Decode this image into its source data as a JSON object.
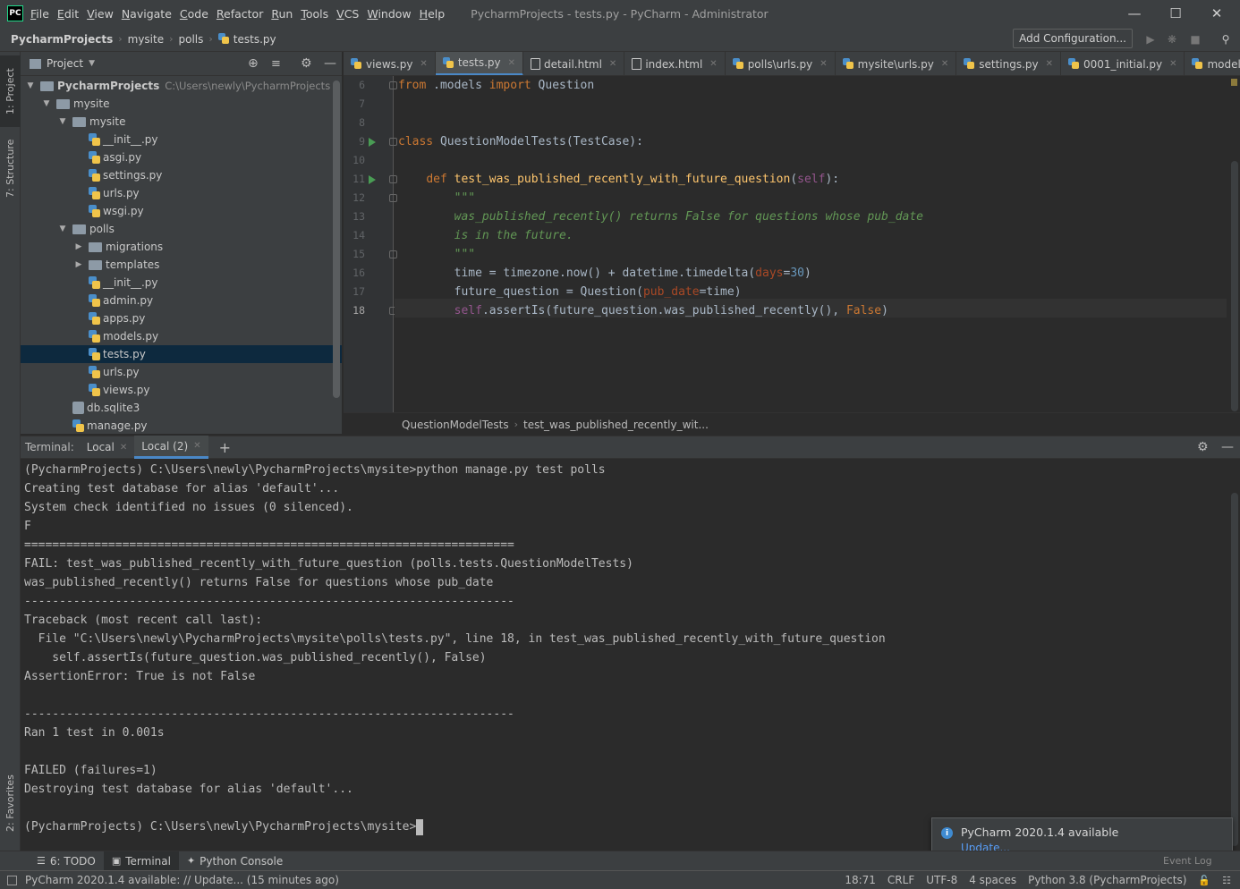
{
  "window": {
    "logo": "PC",
    "menu": [
      "File",
      "Edit",
      "View",
      "Navigate",
      "Code",
      "Refactor",
      "Run",
      "Tools",
      "VCS",
      "Window",
      "Help"
    ],
    "title": "PycharmProjects - tests.py - PyCharm - Administrator",
    "minimize_icon": "minimize-icon",
    "maximize_icon": "maximize-icon",
    "close_icon": "close-icon"
  },
  "navbar": {
    "breadcrumb": [
      "PycharmProjects",
      "mysite",
      "polls",
      "tests.py"
    ],
    "add_configuration": "Add Configuration..."
  },
  "left_strip": {
    "project": "1: Project",
    "structure": "7: Structure",
    "favorites": "2: Favorites"
  },
  "project_panel": {
    "title": "Project",
    "tree": [
      {
        "label": "PycharmProjects",
        "path": "C:\\Users\\newly\\PycharmProjects",
        "type": "folder",
        "depth": 0,
        "expanded": true
      },
      {
        "label": "mysite",
        "type": "folder",
        "depth": 1,
        "expanded": true
      },
      {
        "label": "mysite",
        "type": "folder",
        "depth": 2,
        "expanded": true
      },
      {
        "label": "__init__.py",
        "type": "py",
        "depth": 3
      },
      {
        "label": "asgi.py",
        "type": "py",
        "depth": 3
      },
      {
        "label": "settings.py",
        "type": "py",
        "depth": 3
      },
      {
        "label": "urls.py",
        "type": "py",
        "depth": 3
      },
      {
        "label": "wsgi.py",
        "type": "py",
        "depth": 3
      },
      {
        "label": "polls",
        "type": "folder",
        "depth": 2,
        "expanded": true
      },
      {
        "label": "migrations",
        "type": "folder",
        "depth": 3,
        "expanded": false
      },
      {
        "label": "templates",
        "type": "folder",
        "depth": 3,
        "expanded": false
      },
      {
        "label": "__init__.py",
        "type": "py",
        "depth": 3
      },
      {
        "label": "admin.py",
        "type": "py",
        "depth": 3
      },
      {
        "label": "apps.py",
        "type": "py",
        "depth": 3
      },
      {
        "label": "models.py",
        "type": "py",
        "depth": 3
      },
      {
        "label": "tests.py",
        "type": "py",
        "depth": 3,
        "selected": true
      },
      {
        "label": "urls.py",
        "type": "py",
        "depth": 3
      },
      {
        "label": "views.py",
        "type": "py",
        "depth": 3
      },
      {
        "label": "db.sqlite3",
        "type": "db",
        "depth": 2
      },
      {
        "label": "manage.py",
        "type": "py",
        "depth": 2
      }
    ]
  },
  "editor_tabs": [
    {
      "label": "views.py",
      "icon": "py"
    },
    {
      "label": "tests.py",
      "icon": "py",
      "active": true
    },
    {
      "label": "detail.html",
      "icon": "html"
    },
    {
      "label": "index.html",
      "icon": "html"
    },
    {
      "label": "polls\\urls.py",
      "icon": "py"
    },
    {
      "label": "mysite\\urls.py",
      "icon": "py"
    },
    {
      "label": "settings.py",
      "icon": "py"
    },
    {
      "label": "0001_initial.py",
      "icon": "py"
    },
    {
      "label": "models.py",
      "icon": "py"
    }
  ],
  "code_lines": [
    {
      "n": "6",
      "html": "<span class='kw'>from</span> .models <span class='kw'>import</span> Question"
    },
    {
      "n": "7",
      "html": ""
    },
    {
      "n": "8",
      "html": ""
    },
    {
      "n": "9",
      "html": "<span class='kw'>class</span> QuestionModelTests(TestCase):",
      "run": true
    },
    {
      "n": "10",
      "html": ""
    },
    {
      "n": "11",
      "html": "    <span class='kw'>def</span> <span class='fn'>test_was_published_recently_with_future_question</span>(<span class='self'>self</span>):",
      "run": true
    },
    {
      "n": "12",
      "html": "        <span class='doc'>\"\"\"</span>"
    },
    {
      "n": "13",
      "html": "        <span class='doc'>was_published_recently() returns False for questions whose pub_date</span>"
    },
    {
      "n": "14",
      "html": "        <span class='doc'>is in the future.</span>"
    },
    {
      "n": "15",
      "html": "        <span class='doc'>\"\"\"</span>"
    },
    {
      "n": "16",
      "html": "        time = timezone.now() + datetime.timedelta(<span class='param'>days</span>=<span class='num'>30</span>)"
    },
    {
      "n": "17",
      "html": "        future_question = Question(<span class='param'>pub_date</span>=time)"
    },
    {
      "n": "18",
      "html": "        <span class='self'>self</span>.assertIs(future_question.was_published_recently(), <span class='kw'>False</span>)",
      "current": true
    }
  ],
  "editor_breadcrumb": [
    "QuestionModelTests",
    "test_was_published_recently_wit..."
  ],
  "terminal": {
    "label": "Terminal:",
    "tabs": [
      {
        "label": "Local"
      },
      {
        "label": "Local (2)",
        "active": true
      }
    ],
    "add": "+",
    "lines": [
      "(PycharmProjects) C:\\Users\\newly\\PycharmProjects\\mysite>python manage.py test polls",
      "Creating test database for alias 'default'...",
      "System check identified no issues (0 silenced).",
      "F",
      "======================================================================",
      "FAIL: test_was_published_recently_with_future_question (polls.tests.QuestionModelTests)",
      "was_published_recently() returns False for questions whose pub_date",
      "----------------------------------------------------------------------",
      "Traceback (most recent call last):",
      "  File \"C:\\Users\\newly\\PycharmProjects\\mysite\\polls\\tests.py\", line 18, in test_was_published_recently_with_future_question",
      "    self.assertIs(future_question.was_published_recently(), False)",
      "AssertionError: True is not False",
      "",
      "----------------------------------------------------------------------",
      "Ran 1 test in 0.001s",
      "",
      "FAILED (failures=1)",
      "Destroying test database for alias 'default'...",
      "",
      "(PycharmProjects) C:\\Users\\newly\\PycharmProjects\\mysite>"
    ]
  },
  "bottom_tools": [
    {
      "label": "6: TODO",
      "icon": "todo-icon"
    },
    {
      "label": "Terminal",
      "icon": "terminal-icon",
      "active": true
    },
    {
      "label": "Python Console",
      "icon": "python-console-icon"
    }
  ],
  "notification": {
    "title": "PyCharm 2020.1.4 available",
    "link": "Update...",
    "behind": "Event Log"
  },
  "status": {
    "message": "PyCharm 2020.1.4 available: // Update... (15 minutes ago)",
    "position": "18:71",
    "line_sep": "CRLF",
    "encoding": "UTF-8",
    "indent": "4 spaces",
    "interpreter": "Python 3.8 (PycharmProjects)"
  }
}
